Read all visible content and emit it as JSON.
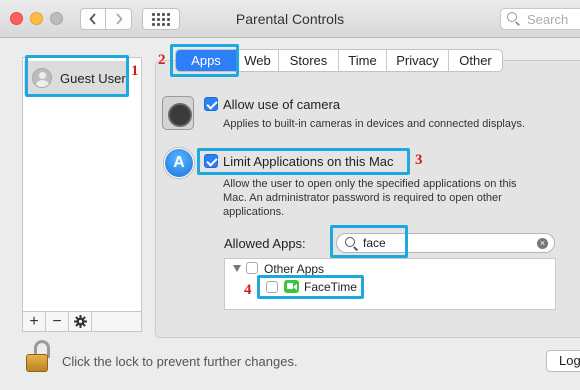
{
  "window": {
    "title": "Parental Controls",
    "search_placeholder": "Search"
  },
  "sidebar": {
    "users": [
      {
        "label": "Guest User"
      }
    ],
    "add_label": "+",
    "remove_label": "−"
  },
  "tabs": [
    {
      "label": "Apps",
      "active": true
    },
    {
      "label": "Web"
    },
    {
      "label": "Stores"
    },
    {
      "label": "Time"
    },
    {
      "label": "Privacy"
    },
    {
      "label": "Other"
    }
  ],
  "apps_panel": {
    "camera": {
      "label": "Allow use of camera",
      "checked": true,
      "description": "Applies to built-in cameras in devices and connected displays."
    },
    "limit_apps": {
      "label": "Limit Applications on this Mac",
      "checked": true,
      "description_lines": [
        "Allow the user to open only the specified applications on this",
        "Mac. An administrator password is required to open other",
        "applications."
      ]
    },
    "allowed_apps": {
      "label": "Allowed Apps:",
      "search_value": "face",
      "groups": [
        {
          "label": "Other Apps",
          "checked": false,
          "expanded": true
        }
      ],
      "items": [
        {
          "label": "FaceTime",
          "checked": false,
          "icon": "facetime-icon"
        }
      ]
    }
  },
  "annotations": {
    "step1": "1",
    "step2": "2",
    "step3": "3",
    "step4": "4",
    "color": "#1ea8e0",
    "number_color": "#d61a1a"
  },
  "footer": {
    "lock_text": "Click the lock to prevent further changes.",
    "login_label": "Log"
  },
  "colors": {
    "accent": "#2d7ff7"
  }
}
